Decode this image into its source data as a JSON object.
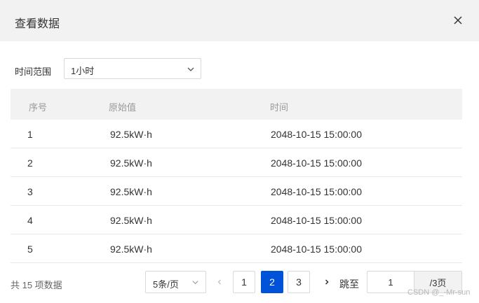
{
  "dialog": {
    "title": "查看数据"
  },
  "filter": {
    "label": "时间范围",
    "value": "1小时"
  },
  "table": {
    "headers": [
      "序号",
      "原始值",
      "时间"
    ],
    "rows": [
      [
        "1",
        "92.5kW·h",
        "2048-10-15 15:00:00"
      ],
      [
        "2",
        "92.5kW·h",
        "2048-10-15 15:00:00"
      ],
      [
        "3",
        "92.5kW·h",
        "2048-10-15 15:00:00"
      ],
      [
        "4",
        "92.5kW·h",
        "2048-10-15 15:00:00"
      ],
      [
        "5",
        "92.5kW·h",
        "2048-10-15 15:00:00"
      ]
    ]
  },
  "pagination": {
    "total_text": "共 15 项数据",
    "page_size": "5条/页",
    "pages": [
      "1",
      "2",
      "3"
    ],
    "current_page": "2",
    "jump_label": "跳至",
    "jump_value": "1",
    "page_suffix": "/3页"
  },
  "watermark": "CSDN @_-Mr-sun",
  "colors": {
    "primary": "#0052d9",
    "header_bg": "#f2f2f2"
  },
  "icons": {
    "close": "close-icon",
    "dropdown": "chevron-down-icon",
    "prev": "chevron-left-icon",
    "next": "chevron-right-icon"
  }
}
